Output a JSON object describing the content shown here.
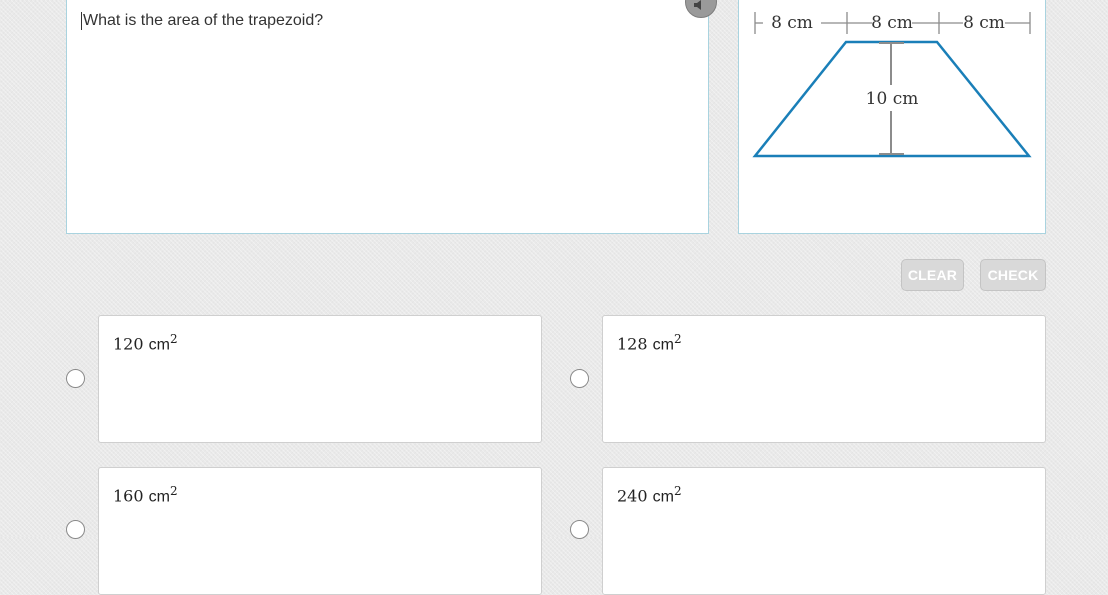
{
  "question": {
    "text": "What is the area of the trapezoid?"
  },
  "figure": {
    "top_segments": [
      "8 cm",
      "8 cm",
      "8 cm"
    ],
    "height_label": "10 cm",
    "shape_color": "#1a7fb8",
    "measure_color": "#8c8c8c"
  },
  "buttons": {
    "clear": "CLEAR",
    "check": "CHECK"
  },
  "choices": [
    {
      "value": "120",
      "unit": "cm",
      "exponent": "2"
    },
    {
      "value": "128",
      "unit": "cm",
      "exponent": "2"
    },
    {
      "value": "160",
      "unit": "cm",
      "exponent": "2"
    },
    {
      "value": "240",
      "unit": "cm",
      "exponent": "2"
    }
  ]
}
